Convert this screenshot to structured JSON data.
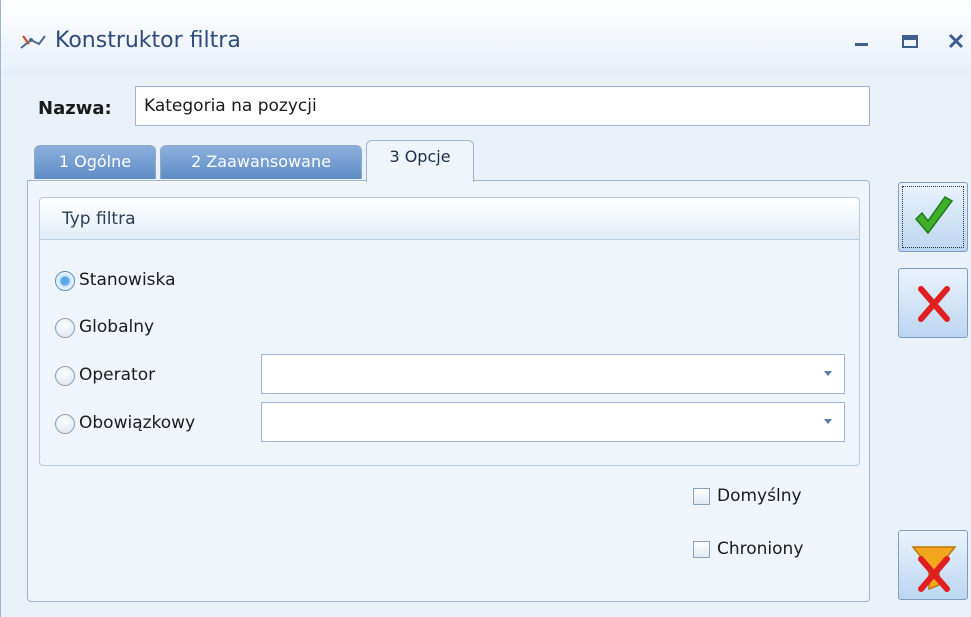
{
  "window": {
    "title": "Konstruktor filtra",
    "icons": {
      "app": "filter-builder-icon",
      "minimize": "minimize-icon",
      "maximize": "maximize-icon",
      "close": "close-icon"
    }
  },
  "name": {
    "label": "Nazwa:",
    "value": "Kategoria na pozycji"
  },
  "tabs": [
    {
      "label": "1 Ogólne",
      "active": false
    },
    {
      "label": "2 Zaawansowane",
      "active": false
    },
    {
      "label": "3 Opcje",
      "active": true
    }
  ],
  "filter_type": {
    "title": "Typ filtra",
    "options": [
      {
        "label": "Stanowiska",
        "selected": true
      },
      {
        "label": "Globalny",
        "selected": false
      },
      {
        "label": "Operator",
        "selected": false
      },
      {
        "label": "Obowiązkowy",
        "selected": false
      }
    ],
    "operator_value": "",
    "obligatory_value": ""
  },
  "checkboxes": [
    {
      "label": "Domyślny",
      "checked": false
    },
    {
      "label": "Chroniony",
      "checked": false
    }
  ],
  "side_buttons": {
    "ok": "checkmark-icon",
    "cancel": "red-x-icon",
    "clear_filter": "funnel-clear-icon"
  },
  "colors": {
    "accent": "#5f8cc6",
    "ok_green": "#34a227",
    "cancel_red": "#e02020",
    "funnel_orange": "#f3a51d"
  }
}
